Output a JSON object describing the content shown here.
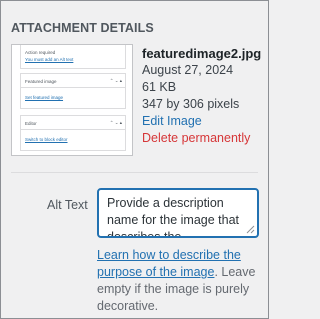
{
  "panel": {
    "heading": "ATTACHMENT DETAILS"
  },
  "thumbnail": {
    "sections": [
      {
        "title": "Action required",
        "link": "You must add an Alt text"
      },
      {
        "title": "Featured image",
        "link": "Set featured image"
      },
      {
        "title": "Editor",
        "link": "Switch to block editor"
      }
    ]
  },
  "file": {
    "name": "featuredimage2.jpg",
    "date": "August 27, 2024",
    "size": "61 KB",
    "dimensions": "347 by 306 pixels",
    "edit_label": "Edit Image",
    "delete_label": "Delete permanently"
  },
  "alt_text": {
    "label": "Alt Text",
    "value": "Provide a description name for the image that describes the"
  },
  "help": {
    "link_text": "Learn how to describe the purpose of the image",
    "trailing_text": ". Leave empty if the image is purely decorative."
  },
  "colors": {
    "link": "#2271b1",
    "delete": "#d63638",
    "focus_border": "#2271b1"
  }
}
